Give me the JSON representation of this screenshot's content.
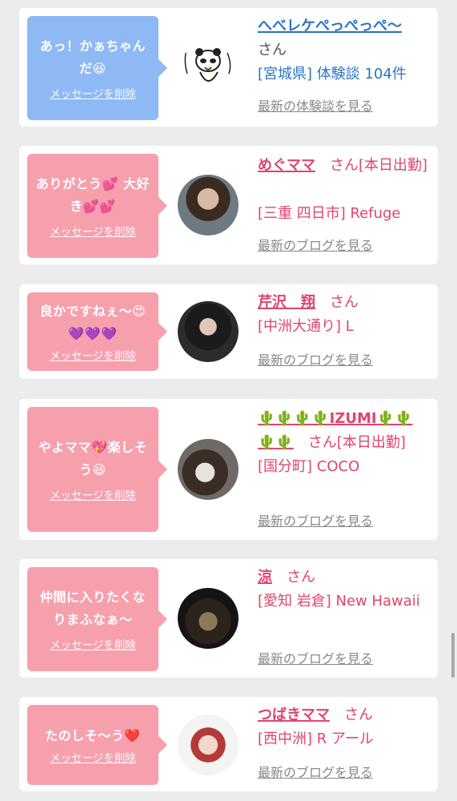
{
  "items": [
    {
      "message": "あっ！かぁちゃんだ😆",
      "delete_label": "メッセージを削除",
      "name": "へべレケぺっぺっぺ〜",
      "suffix": "さん",
      "place": "[宮城県] 体験談 104件",
      "more": "最新の体験談を見る",
      "bubble_color": "#8eb9f4"
    },
    {
      "message": "ありがとう💕 大好き💕💕",
      "delete_label": "メッセージを削除",
      "name": "めぐママ",
      "suffix": "さん[本日出勤]",
      "place": "[三重 四日市] Refuge",
      "more": "最新のブログを見る",
      "bubble_color": "#f6a0ae"
    },
    {
      "message": "良かですねぇ〜😍💜💜💜",
      "delete_label": "メッセージを削除",
      "name": "芹沢　翔",
      "suffix": "さん",
      "place": "[中洲大通り] L",
      "more": "最新のブログを見る",
      "bubble_color": "#f6a0ae"
    },
    {
      "message": "やよママ💖楽しそう😆",
      "delete_label": "メッセージを削除",
      "name": "🌵🌵🌵🌵IZUMI🌵🌵🌵🌵",
      "suffix": "さん[本日出勤]",
      "place": "[国分町] COCO",
      "more": "最新のブログを見る",
      "bubble_color": "#f6a0ae"
    },
    {
      "message": "仲間に入りたくなりまふなぁ〜",
      "delete_label": "メッセージを削除",
      "name": "涼",
      "suffix": "さん",
      "place": "[愛知 岩倉] New Hawaii",
      "more": "最新のブログを見る",
      "bubble_color": "#f6a0ae"
    },
    {
      "message": "たのしそ〜う❤️",
      "delete_label": "メッセージを削除",
      "name": "つばきママ",
      "suffix": "さん",
      "place": "[西中洲] R アール",
      "more": "最新のブログを見る",
      "bubble_color": "#f6a0ae"
    }
  ]
}
